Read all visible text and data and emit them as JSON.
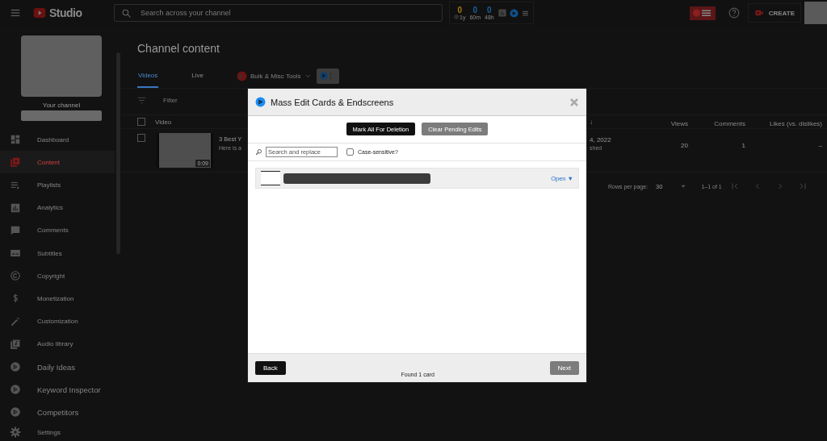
{
  "header": {
    "logo_text": "Studio",
    "search_placeholder": "Search across your channel",
    "stats": [
      {
        "value": "0",
        "label": "1y",
        "color": "#a07a10"
      },
      {
        "value": "0",
        "label": "60m",
        "color": "#1a5fa0"
      },
      {
        "value": "0",
        "label": "48h",
        "color": "#1a5fa0"
      }
    ],
    "create_label": "CREATE"
  },
  "sidebar": {
    "channel_label": "Your channel",
    "items": [
      {
        "label": "Dashboard",
        "selected": false,
        "kind": "nav"
      },
      {
        "label": "Content",
        "selected": true,
        "kind": "nav"
      },
      {
        "label": "Playlists",
        "selected": false,
        "kind": "nav"
      },
      {
        "label": "Analytics",
        "selected": false,
        "kind": "nav"
      },
      {
        "label": "Comments",
        "selected": false,
        "kind": "nav"
      },
      {
        "label": "Subtitles",
        "selected": false,
        "kind": "nav"
      },
      {
        "label": "Copyright",
        "selected": false,
        "kind": "nav"
      },
      {
        "label": "Monetization",
        "selected": false,
        "kind": "nav"
      },
      {
        "label": "Customization",
        "selected": false,
        "kind": "nav"
      },
      {
        "label": "Audio library",
        "selected": false,
        "kind": "nav"
      },
      {
        "label": "Daily Ideas",
        "selected": false,
        "kind": "extension"
      },
      {
        "label": "Keyword Inspector",
        "selected": false,
        "kind": "extension"
      },
      {
        "label": "Competitors",
        "selected": false,
        "kind": "extension"
      },
      {
        "label": "Settings",
        "selected": false,
        "kind": "nav"
      }
    ]
  },
  "page_title": "Channel content",
  "tabs": [
    {
      "label": "Videos",
      "selected": true
    },
    {
      "label": "Live",
      "selected": false
    }
  ],
  "tools_menu": {
    "label": "Bulk & Misc Tools"
  },
  "filter_placeholder": "Filter",
  "table": {
    "columns": [
      "Video",
      "↓",
      "Views",
      "Comments",
      "Likes (vs. dislikes)"
    ],
    "header_checked": false,
    "rows": [
      {
        "checked": false,
        "duration": "0:09",
        "title": "3 Best Y",
        "description": "Here is a",
        "date": "4, 2022",
        "status": "shed",
        "views": "20",
        "comments": "1",
        "likes": "–"
      }
    ],
    "rows_per_page_label": "Rows per page:",
    "rows_per_page": "30",
    "range": "1–1 of 1"
  },
  "dialog": {
    "title": "Mass Edit Cards & Endscreens",
    "actions": [
      {
        "label": "Mark All For Deletion",
        "kind": "primary"
      },
      {
        "label": "Clear Pending Edits",
        "kind": "secondary"
      }
    ],
    "search_placeholder": "Search and replace",
    "case_sensitive": {
      "label": "Case-sensitive?",
      "checked": false
    },
    "cards": [
      {
        "open_label": "Open ▼"
      }
    ],
    "back_label": "Back",
    "next_label": "Next",
    "next_disabled": true,
    "status": "Found 1 card"
  }
}
